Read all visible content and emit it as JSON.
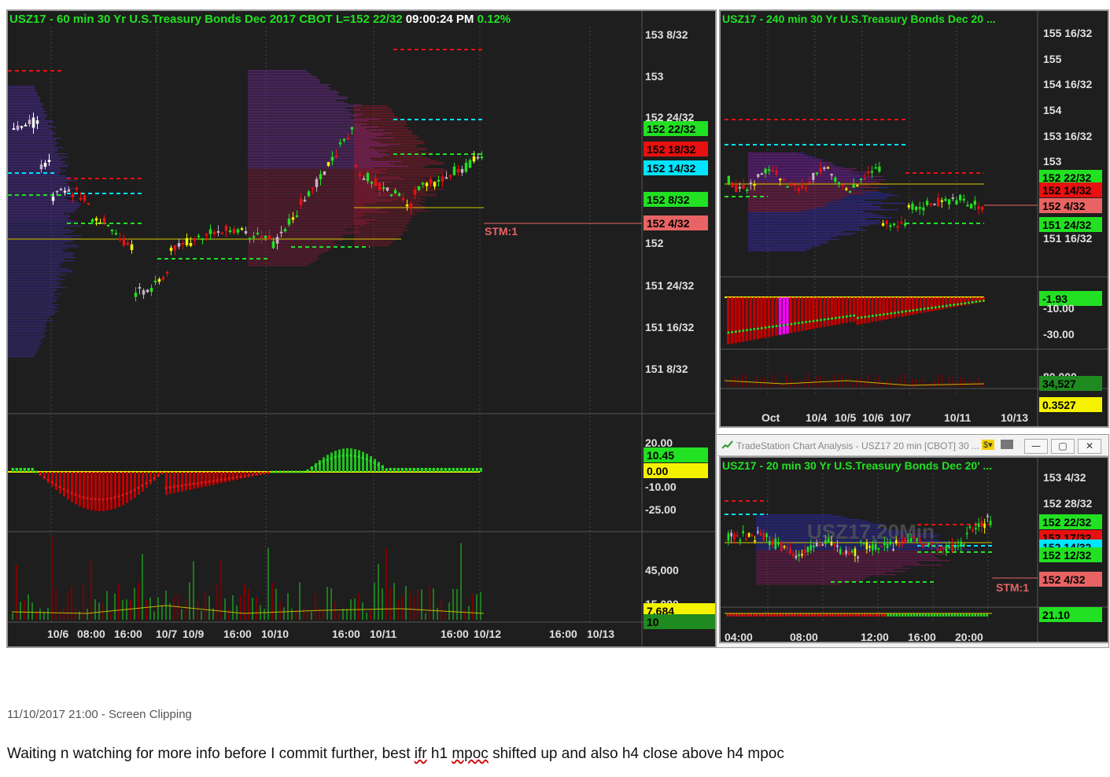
{
  "colors": {
    "bg": "#1e1e1e",
    "green": "#22e022",
    "red": "#e81010",
    "cyan": "#00e5ff",
    "yellow": "#f5f200",
    "grid": "#2e2e2e",
    "salmon": "#e86464"
  },
  "main_chart": {
    "title_prefix": "USZ17 - 60 min  30 Yr U.S.Treasury Bonds Dec 2017  CBOT  L=152 22/32",
    "time": "09:00:24 PM",
    "change": "0.12%",
    "price_axis": [
      "153 8/32",
      "153",
      "152 24/32",
      "152",
      "151 24/32",
      "151 16/32",
      "151 8/32"
    ],
    "price_tags": [
      {
        "label": "152 22/32",
        "color": "green"
      },
      {
        "label": "152 18/32",
        "color": "red"
      },
      {
        "label": "152 14/32",
        "color": "cyan"
      },
      {
        "label": "152 8/32",
        "color": "green"
      },
      {
        "label": "152 4/32",
        "color": "salmon"
      }
    ],
    "stm_label": "STM:1",
    "osc_axis": [
      "20.00",
      "-10.00",
      "-25.00"
    ],
    "osc_tags": [
      {
        "label": "10.45",
        "color": "green"
      },
      {
        "label": "0.00",
        "color": "yellow"
      }
    ],
    "vol_axis": [
      "45,000",
      "15,000"
    ],
    "vol_tags": [
      {
        "label": "7,684",
        "color": "yellow"
      },
      {
        "label": "10",
        "color": "darkgreen"
      }
    ],
    "time_axis": [
      "10/6",
      "08:00",
      "16:00",
      "10/7",
      "10/9",
      "16:00",
      "10/10",
      "16:00",
      "10/11",
      "16:00",
      "10/12",
      "16:00",
      "10/13"
    ]
  },
  "h4_chart": {
    "title": "USZ17 - 240 min  30 Yr U.S.Treasury Bonds Dec 20 ...",
    "price_axis": [
      "155 16/32",
      "155",
      "154 16/32",
      "154",
      "153 16/32",
      "153",
      "151 16/32"
    ],
    "price_tags": [
      {
        "label": "152 22/32",
        "color": "green"
      },
      {
        "label": "152 14/32",
        "color": "red"
      },
      {
        "label": "152 4/32",
        "color": "salmon"
      },
      {
        "label": "151 24/32",
        "color": "green"
      }
    ],
    "osc_axis": [
      "-10.00",
      "-30.00"
    ],
    "osc_tags": [
      {
        "label": "-1.93",
        "color": "green"
      }
    ],
    "vol_axis": [
      "80,000"
    ],
    "vol_tags": [
      {
        "label": "34,527",
        "color": "darkgreen"
      },
      {
        "label": "0.3527",
        "color": "yellow"
      }
    ],
    "time_axis": [
      "Oct",
      "10/4",
      "10/5",
      "10/6",
      "10/7",
      "10/11",
      "10/13"
    ]
  },
  "m20_window": {
    "window_title": "TradeStation Chart Analysis - USZ17 20 min [CBOT] 30 ...",
    "badge": "$▾",
    "title": "USZ17 - 20 min  30 Yr U.S.Treasury Bonds Dec 20' ...",
    "watermark": "USZ17,20Min",
    "price_axis": [
      "153 4/32",
      "152 28/32"
    ],
    "price_tags": [
      {
        "label": "152 22/32",
        "color": "green"
      },
      {
        "label": "152 17/32",
        "color": "red"
      },
      {
        "label": "152 14/32",
        "color": "cyan"
      },
      {
        "label": "152 12/32",
        "color": "green"
      },
      {
        "label": "152 4/32",
        "color": "salmon"
      }
    ],
    "stm_label": "STM:1",
    "osc_tags": [
      {
        "label": "21.10",
        "color": "green"
      }
    ],
    "time_axis": [
      "04:00",
      "08:00",
      "12:00",
      "16:00",
      "20:00"
    ]
  },
  "note": {
    "date": "11/10/2017 21:00 - Screen Clipping",
    "text_1": "Waiting n watching for more info before I commit further, best ",
    "text_ifr": "ifr",
    "text_2": " h1 ",
    "text_mpoc": "mpoc",
    "text_3": " shifted up and also h4 close above h4 mpoc"
  }
}
